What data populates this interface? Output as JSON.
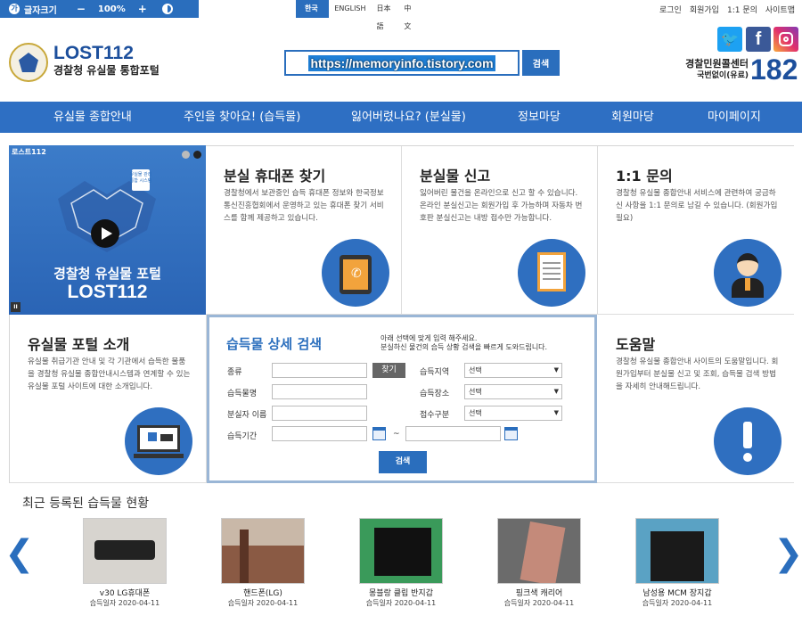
{
  "topbar": {
    "font_size_label": "글자크기",
    "minus": "−",
    "zoom": "100%",
    "plus": "+",
    "languages": [
      "한국어",
      "ENGLISH",
      "日本語",
      "中文"
    ],
    "util_links": [
      "로그인",
      "회원가입",
      "1:1 문의",
      "사이트맵"
    ]
  },
  "header": {
    "logo_title": "LOST112",
    "logo_subtitle": "경찰청 유실물 통합포털",
    "search_value": "https://memoryinfo.tistory.com",
    "search_button": "검색",
    "sns": [
      "twitter-icon",
      "facebook-icon",
      "instagram-icon"
    ],
    "call_center_label": "경찰민원콜센터",
    "call_center_sub": "국번없이(유료)",
    "call_number": "182"
  },
  "nav": [
    "유실물 종합안내",
    "주인을 찾아요! (습득물)",
    "잃어버렸나요? (분실물)",
    "정보마당",
    "회원마당",
    "마이페이지"
  ],
  "video": {
    "tag": "로스트112",
    "title1": "경찰청 유실물 포털",
    "title2": "LOST112",
    "badge": "유실물 관리 통합 시스템",
    "pause": "II"
  },
  "cards": {
    "phone": {
      "title": "분실 휴대폰 찾기",
      "desc": "경찰청에서 보관중인 습득 휴대폰 정보와 한국정보통신진흥협회에서 운영하고 있는 휴대폰 찾기 서비스를 함께 제공하고 있습니다."
    },
    "report": {
      "title": "분실물 신고",
      "desc": "잃어버린 물건을 온라인으로 신고 할 수 있습니다. 온라인 분실신고는 회원가입 후 가능하며 자동차 번호판 분실신고는 내방 접수만 가능합니다."
    },
    "inquiry": {
      "title": "1:1 문의",
      "desc": "경찰청 유실물 종합안내 서비스에 관련하여 궁금하신 사항을 1:1 문의로 남길 수 있습니다. (회원가입 필요)"
    },
    "intro": {
      "title": "유실물 포털 소개",
      "desc": "유실물 취급기관 안내 및 각 기관에서 습득한 물품을 경찰청 유실물 종합안내시스템과 연계할 수 있는 유실물 포털 사이트에 대한 소개입니다."
    },
    "help": {
      "title": "도움말",
      "desc": "경찰청 유실물 종합안내 사이트의 도움말입니다. 회원가입부터 분실물 신고 및 조회, 습득물 검색 방법을 자세히 안내해드립니다."
    }
  },
  "search_form": {
    "title": "습득물 상세 검색",
    "notice1": "아래 선택에 맞게 입력 해주세요.",
    "notice2": "분실하신 물건의 습득 상황 검색을 빠르게 도와드립니다.",
    "label_type": "종류",
    "find_button": "찾기",
    "label_region": "습득지역",
    "region_value": "선택",
    "label_name": "습득물명",
    "label_place": "습득장소",
    "place_value": "선택",
    "label_owner": "분실자 이름",
    "label_receipt": "접수구분",
    "receipt_value": "선택",
    "label_period": "습득기간",
    "tilde": "~",
    "submit": "검색"
  },
  "recent": {
    "title": "최근 등록된 습득물 현황",
    "prev": "❮",
    "next": "❯",
    "items": [
      {
        "name": "v30 LG휴대폰",
        "date": "습득일자 2020-04-11"
      },
      {
        "name": "핸드폰(LG)",
        "date": "습득일자 2020-04-11"
      },
      {
        "name": "몽블랑 클립 반지갑",
        "date": "습득일자 2020-04-11"
      },
      {
        "name": "핑크색 캐리어",
        "date": "습득일자 2020-04-11"
      },
      {
        "name": "남성용 MCM 장지갑",
        "date": "습득일자 2020-04-11"
      }
    ]
  }
}
